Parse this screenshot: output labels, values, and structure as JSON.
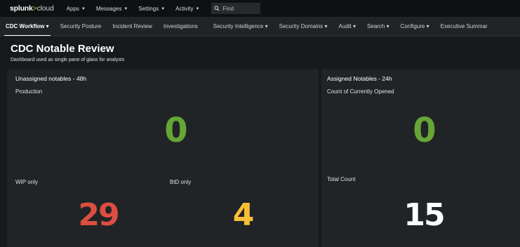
{
  "topbar": {
    "logo": {
      "brand": "splunk",
      "gt": ">",
      "product": "cloud"
    },
    "menu": [
      {
        "label": "Apps",
        "has_caret": true
      },
      {
        "label": "Messages",
        "has_caret": true
      },
      {
        "label": "Settings",
        "has_caret": true
      },
      {
        "label": "Activity",
        "has_caret": true
      }
    ],
    "find_label": "Find",
    "find_icon": "search-icon"
  },
  "appnav": {
    "items": [
      {
        "label": "CDC Workflow",
        "caret": "▾",
        "active": true
      },
      {
        "label": "Security Posture",
        "caret": "",
        "active": false
      },
      {
        "label": "Incident Review",
        "caret": "",
        "active": false
      },
      {
        "label": "Investigations",
        "caret": "",
        "active": false
      },
      {
        "label": "Security Intelligence",
        "caret": "▾",
        "active": false
      },
      {
        "label": "Security Domains",
        "caret": "▾",
        "active": false
      },
      {
        "label": "Audit",
        "caret": "▾",
        "active": false
      },
      {
        "label": "Search",
        "caret": "▾",
        "active": false
      },
      {
        "label": "Configure",
        "caret": "▾",
        "active": false
      },
      {
        "label": "Executive Summar",
        "caret": "",
        "active": false
      }
    ]
  },
  "dashboard": {
    "title": "CDC Notable Review",
    "description": "Dashboard used as single pane of glass for analysts"
  },
  "panels": {
    "unassigned": {
      "title": "Unassigned notables - 48h",
      "production": {
        "label": "Production",
        "value": "0"
      },
      "wip": {
        "label": "WIP only",
        "value": "29"
      },
      "btd": {
        "label": "BtD only",
        "value": "4"
      }
    },
    "assigned": {
      "title": "Assigned Notables - 24h",
      "opened": {
        "label": "Count of Currently Opened",
        "value": "0"
      },
      "total": {
        "label": "Total Count",
        "value": "15"
      }
    }
  },
  "colors": {
    "green": "#65a637",
    "red": "#dc4e41",
    "yellow": "#f8be34",
    "white": "#ffffff"
  }
}
